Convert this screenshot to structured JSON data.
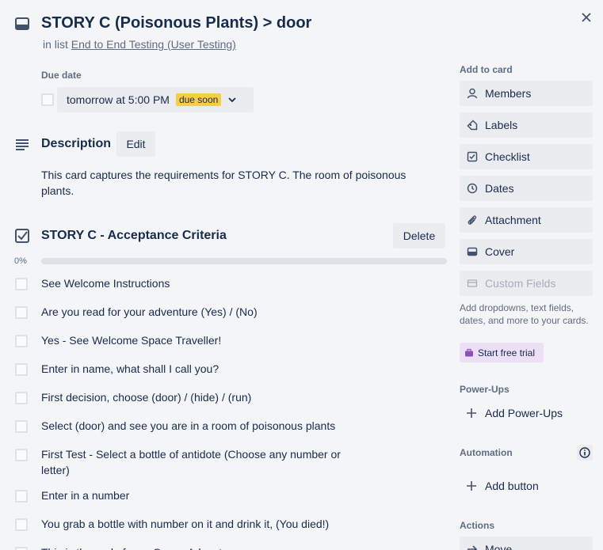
{
  "header": {
    "title": "STORY C (Poisonous Plants) > door",
    "in_list_prefix": "in list ",
    "list_name": "End to End Testing (User Testing)"
  },
  "due": {
    "label": "Due date",
    "value": "tomorrow at 5:00 PM",
    "badge": "due soon",
    "badge_color": "#f5cd47"
  },
  "description": {
    "title": "Description",
    "edit_label": "Edit",
    "text": "This card captures the requirements for STORY C. The room of poisonous plants."
  },
  "checklist": {
    "title": "STORY C - Acceptance Criteria",
    "delete_label": "Delete",
    "percent": "0%",
    "progress_fraction": 0,
    "items": [
      "See Welcome Instructions",
      "Are you read for your adventure (Yes) / (No)",
      "Yes - See Welcome Space Traveller!",
      "Enter in name, what shall I call you?",
      "First decision, choose (door) / (hide) / (run)",
      "Select (door) and see you are in a room of poisonous plants",
      "First Test - Select a bottle of antidote (Choose any number or letter)",
      "Enter in a number",
      "You grab a bottle with number on it and drink it, (You died!)",
      "This is the end of your Space Adventure"
    ]
  },
  "sidebar": {
    "add_to_card": "Add to card",
    "buttons": [
      {
        "label": "Members",
        "icon": "person-icon"
      },
      {
        "label": "Labels",
        "icon": "tag-icon"
      },
      {
        "label": "Checklist",
        "icon": "checklist-icon"
      },
      {
        "label": "Dates",
        "icon": "clock-icon"
      },
      {
        "label": "Attachment",
        "icon": "paperclip-icon"
      },
      {
        "label": "Cover",
        "icon": "cover-icon"
      },
      {
        "label": "Custom Fields",
        "icon": "custom-fields-icon"
      }
    ],
    "custom_fields_note": "Add dropdowns, text fields, dates, and more to your cards.",
    "trial_label": "Start free trial",
    "powerups_head": "Power-Ups",
    "add_powerups": "Add Power-Ups",
    "automation_head": "Automation",
    "add_button": "Add button",
    "actions_head": "Actions",
    "move": "Move"
  }
}
